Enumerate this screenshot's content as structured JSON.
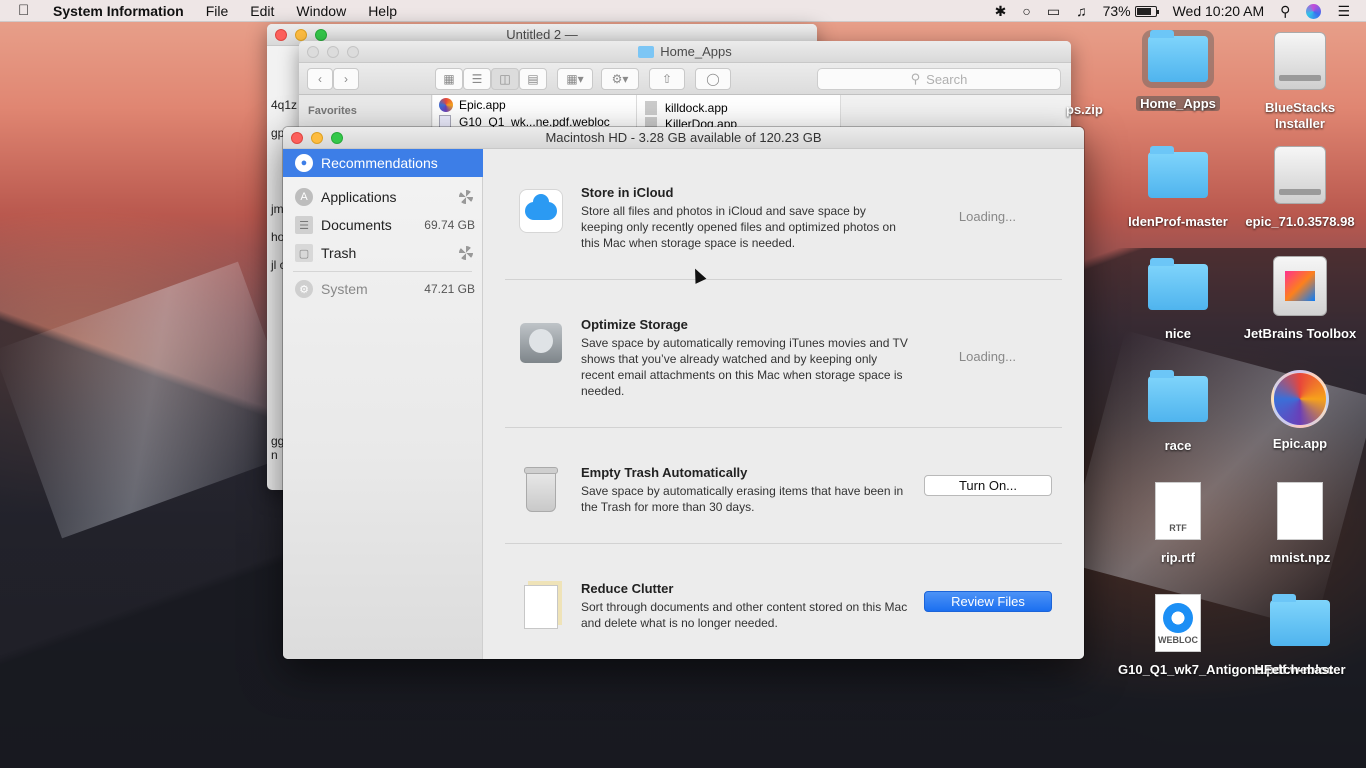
{
  "menubar": {
    "app_name": "System Information",
    "items": [
      "File",
      "Edit",
      "Window",
      "Help"
    ],
    "battery_percent": "73%",
    "battery_level": 0.73,
    "clock": "Wed 10:20 AM"
  },
  "bg_textedit": {
    "title": "Untitled 2 —",
    "snippets": [
      "4q1z",
      "gp",
      "jm",
      "ho",
      "jl c",
      "gg",
      "n"
    ]
  },
  "finder": {
    "title": "Home_Apps",
    "search_placeholder": "Search",
    "sidebar_header": "Favorites",
    "col1": [
      "Epic.app",
      "G10_Q1_wk...ne.pdf.webloc"
    ],
    "col2": [
      "killdock.app",
      "KillerDog.app"
    ],
    "partial_label": "ps.zip"
  },
  "storage_window": {
    "title": "Macintosh HD - 3.28 GB available of 120.23 GB",
    "sidebar": {
      "recommendations": "Recommendations",
      "applications": "Applications",
      "documents": "Documents",
      "documents_size": "69.74 GB",
      "trash": "Trash",
      "system": "System",
      "system_size": "47.21 GB"
    },
    "recommendations": [
      {
        "title": "Store in iCloud",
        "desc": "Store all files and photos in iCloud and save space by keeping only recently opened files and optimized photos on this Mac when storage space is needed.",
        "status": "Loading..."
      },
      {
        "title": "Optimize Storage",
        "desc": "Save space by automatically removing iTunes movies and TV shows that you’ve already watched and by keeping only recent email attachments on this Mac when storage space is needed.",
        "status": "Loading..."
      },
      {
        "title": "Empty Trash Automatically",
        "desc": "Save space by automatically erasing items that have been in the Trash for more than 30 days.",
        "button": "Turn On..."
      },
      {
        "title": "Reduce Clutter",
        "desc": "Sort through documents and other content stored on this Mac and delete what is no longer needed.",
        "button": "Review Files"
      }
    ]
  },
  "desktop": {
    "icons": {
      "home_apps": "Home_Apps",
      "bluestacks": "BlueStacks Installer",
      "idenprof": "IdenProf-master",
      "epic_dmg": "epic_71.0.3578.98",
      "nice": "nice",
      "jetbrains": "JetBrains Toolbox",
      "race": "race",
      "epic_app": "Epic.app",
      "rip": "rip.rtf",
      "mnist": "mnist.npz",
      "webloc": "G10_Q1_wk7_Antigone.pdf.webloc",
      "hfetch": "HFetch-master"
    },
    "doc_badges": {
      "rtf": "RTF",
      "webloc": "WEBLOC"
    }
  },
  "colors": {
    "accent": "#3d7ee7",
    "primary_button": "#1b6ff0",
    "folder": "#4fb4ee"
  }
}
